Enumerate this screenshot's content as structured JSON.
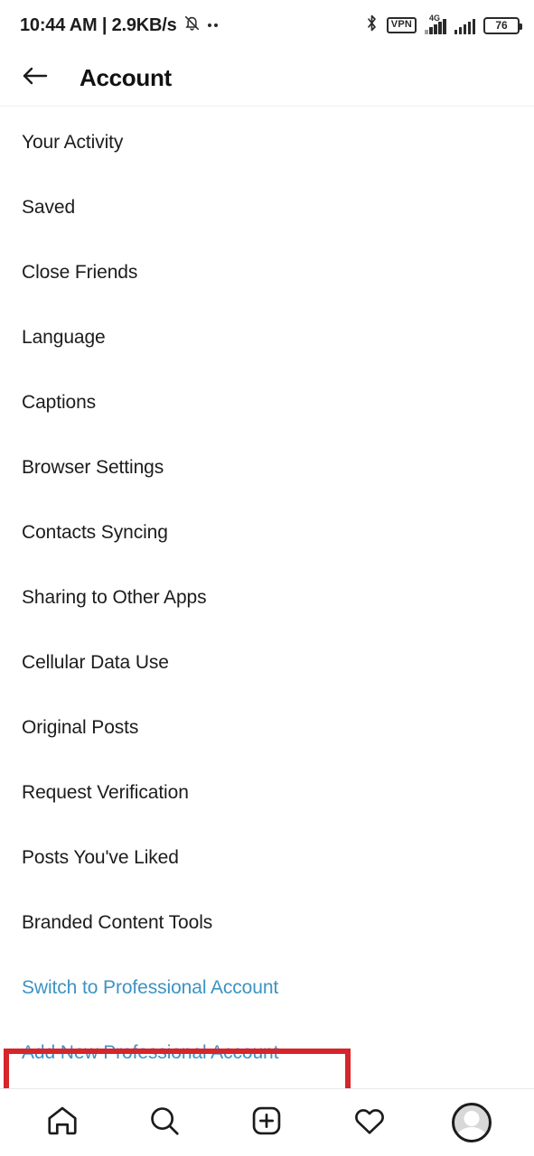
{
  "status_bar": {
    "clock": "10:44 AM | 2.9KB/s",
    "bell_icon": "bell-muted-icon",
    "overflow_dots_icon": "more-dots-icon",
    "bluetooth_icon": "bluetooth-icon",
    "vpn_label": "VPN",
    "network_type": "4G",
    "signal_icon": "signal-bars-icon",
    "battery_level": "76",
    "battery_icon": "battery-icon"
  },
  "header": {
    "back_icon": "back-arrow-icon",
    "title": "Account"
  },
  "menu": {
    "items": [
      {
        "label": "Your Activity",
        "type": "default"
      },
      {
        "label": "Saved",
        "type": "default"
      },
      {
        "label": "Close Friends",
        "type": "default"
      },
      {
        "label": "Language",
        "type": "default"
      },
      {
        "label": "Captions",
        "type": "default"
      },
      {
        "label": "Browser Settings",
        "type": "default"
      },
      {
        "label": "Contacts Syncing",
        "type": "default"
      },
      {
        "label": "Sharing to Other Apps",
        "type": "default"
      },
      {
        "label": "Cellular Data Use",
        "type": "default"
      },
      {
        "label": "Original Posts",
        "type": "default"
      },
      {
        "label": "Request Verification",
        "type": "default"
      },
      {
        "label": "Posts You've Liked",
        "type": "default"
      },
      {
        "label": "Branded Content Tools",
        "type": "default"
      },
      {
        "label": "Switch to Professional Account",
        "type": "link"
      },
      {
        "label": "Add New Professional Account",
        "type": "link"
      }
    ]
  },
  "annotation": {
    "highlight_target": "Switch to Professional Account",
    "color": "#d6252b"
  },
  "bottom_nav": {
    "items": [
      {
        "icon": "home-icon",
        "name": "nav-home"
      },
      {
        "icon": "search-icon",
        "name": "nav-search"
      },
      {
        "icon": "add-post-icon",
        "name": "nav-add-post"
      },
      {
        "icon": "heart-icon",
        "name": "nav-activity"
      },
      {
        "icon": "profile-avatar-icon",
        "name": "nav-profile"
      }
    ]
  },
  "colors": {
    "link_blue": "#3d93c4",
    "text_primary": "#1c1c1c",
    "highlight_red": "#d6252b",
    "background": "#ffffff"
  }
}
